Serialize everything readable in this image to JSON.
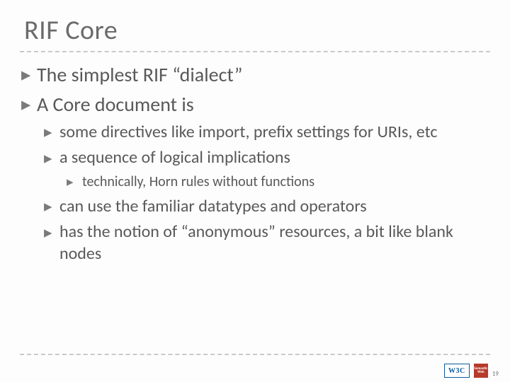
{
  "title": "RIF Core",
  "bullets": {
    "l1_a": "The simplest RIF “dialect”",
    "l1_b": "A Core document is",
    "l2_a": "some directives like import, prefix settings for URIs, etc",
    "l2_b": "a sequence of logical implications",
    "l3_a": "technically, Horn rules without functions",
    "l2_c": "can use the familiar datatypes and operators",
    "l2_d": "has the notion of “anonymous” resources, a bit like blank nodes"
  },
  "footer": {
    "w3c": "W3C",
    "sw": "Semantic Web",
    "page": "19"
  }
}
